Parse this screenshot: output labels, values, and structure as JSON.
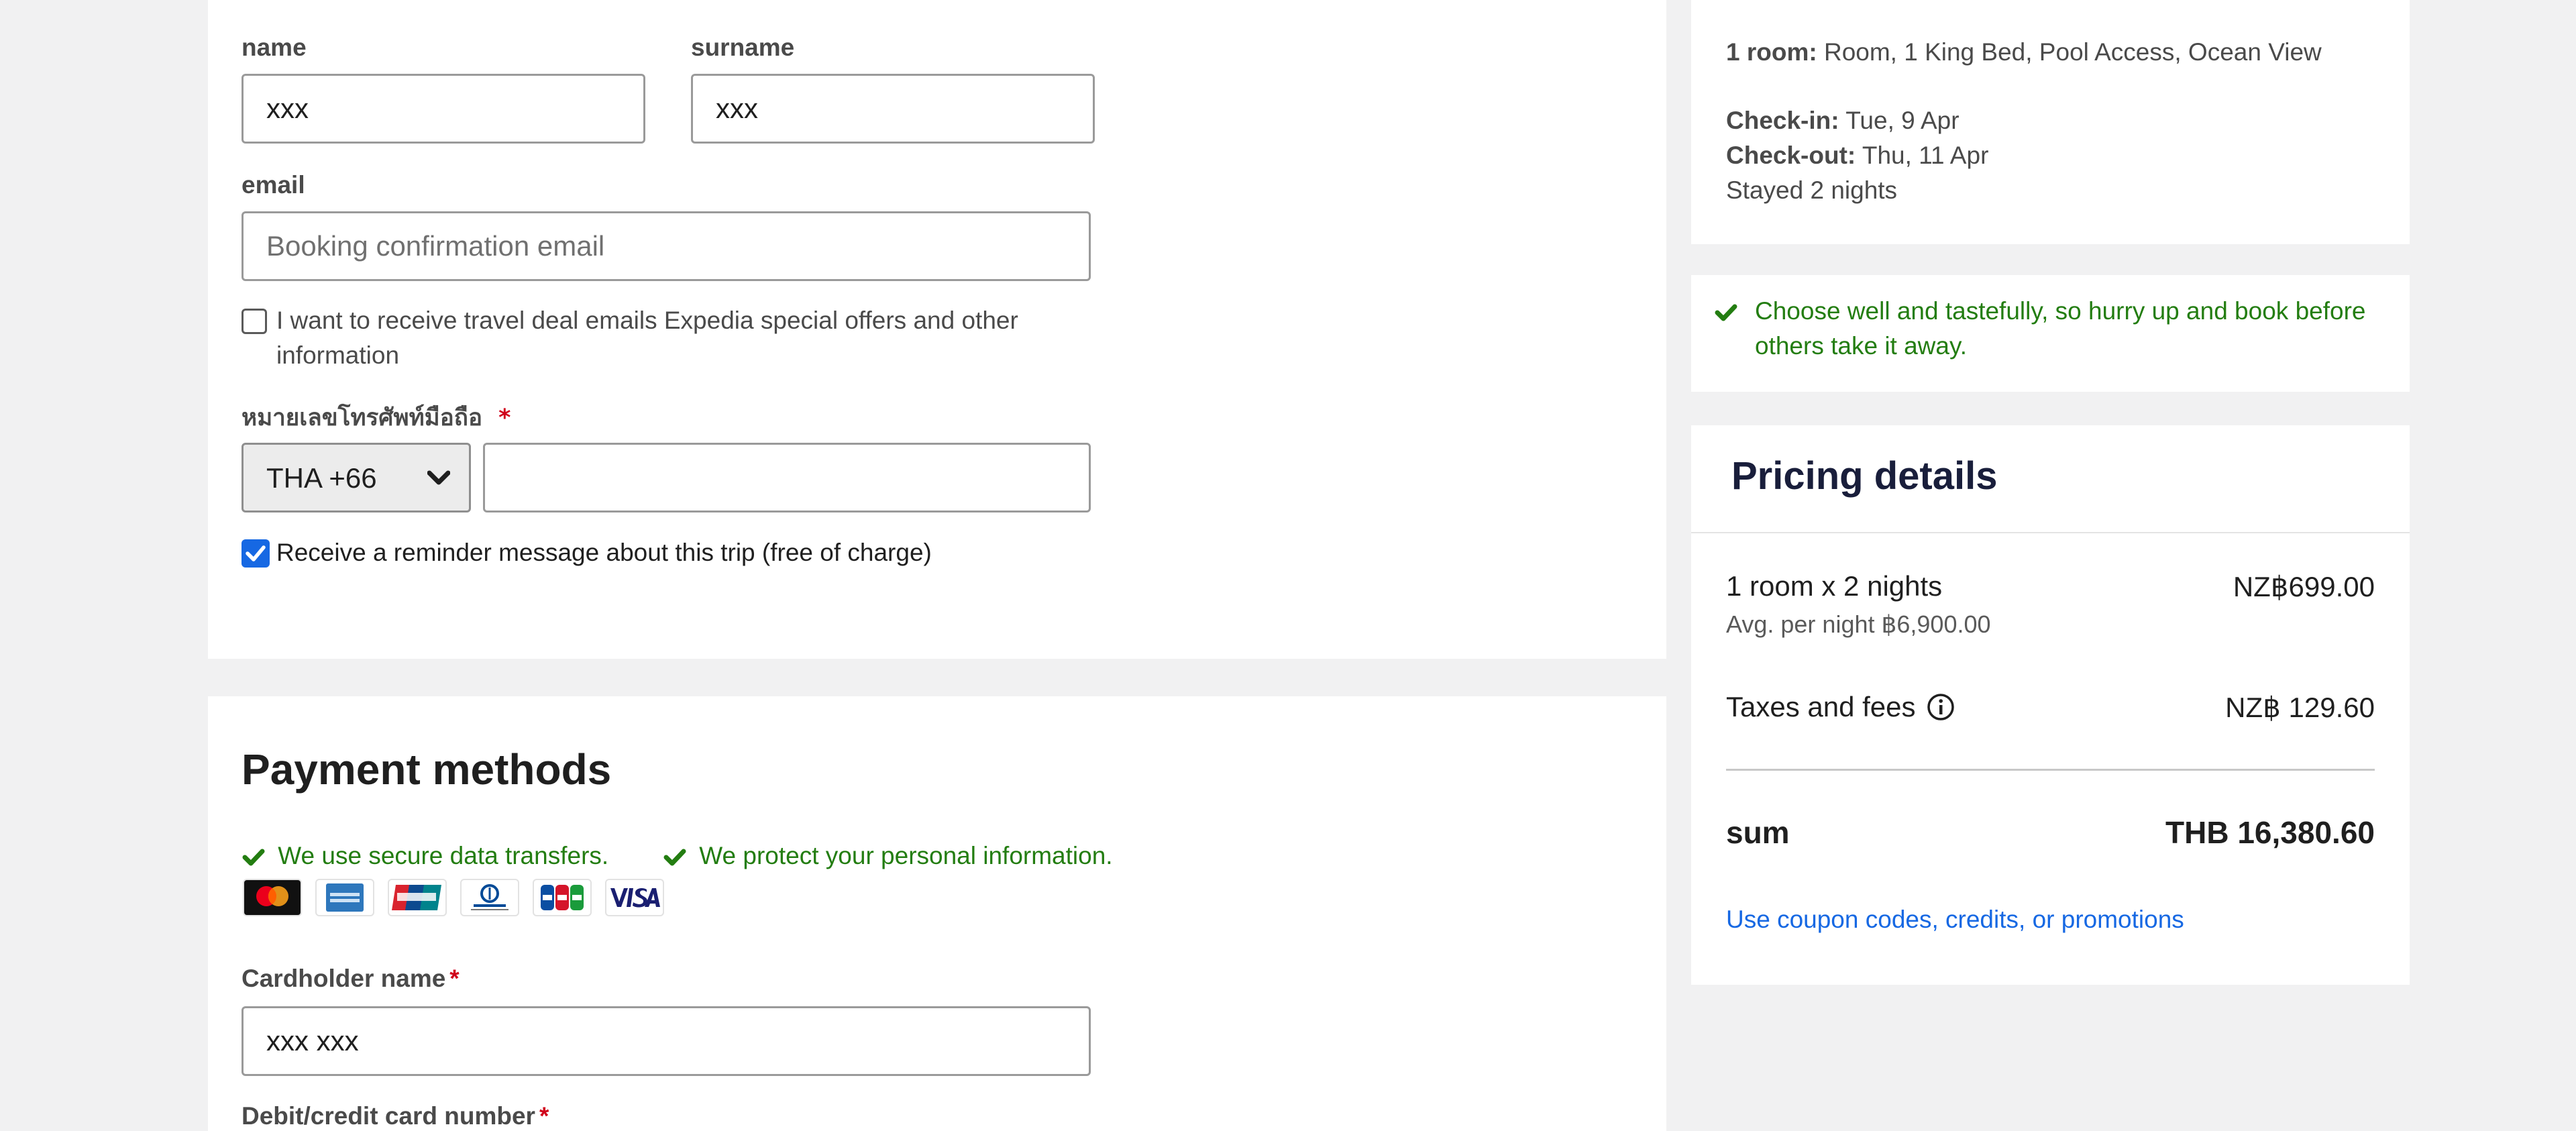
{
  "contact_form": {
    "name_label": "name",
    "name_value": "xxx",
    "surname_label": "surname",
    "surname_value": "xxx",
    "email_label": "email",
    "email_placeholder": "Booking confirmation email",
    "deals_checkbox_line1": "I want to receive travel deal emails Expedia special offers and other",
    "deals_checkbox_line2": "information",
    "deals_checked": false,
    "phone_label": "หมายเลขโทรศัพท์มือถือ",
    "phone_required": "*",
    "country_code": "THA +66",
    "phone_value": "",
    "reminder_label": "Receive a reminder message about this trip (free of charge)",
    "reminder_checked": true
  },
  "payment": {
    "title": "Payment methods",
    "secure_note": "We use secure data transfers.",
    "protect_note": "We protect your personal information.",
    "card_brands": [
      "Mastercard",
      "American Express",
      "UnionPay",
      "Diners Club",
      "JCB",
      "VISA"
    ],
    "cardholder_label": "Cardholder name",
    "cardholder_required": "*",
    "cardholder_value": "xxx xxx",
    "card_number_label": "Debit/credit card number",
    "card_number_required": "*"
  },
  "stay_summary": {
    "room_label": "1 room:",
    "room_value": " Room, 1 King Bed, Pool Access, Ocean View",
    "checkin_label": "Check-in:",
    "checkin_value": " Tue, 9 Apr",
    "checkout_label": "Check-out:",
    "checkout_value": " Thu, 11 Apr",
    "stayed": "Stayed 2 nights"
  },
  "urgency": {
    "line1": "Choose well and tastefully, so hurry up and book before",
    "line2": "others take it away."
  },
  "pricing": {
    "title": "Pricing details",
    "room_nights": "1 room x 2 nights",
    "room_nights_price": "NZ฿699.00",
    "avg_per_night": "Avg. per night ฿6,900.00",
    "taxes_label": "Taxes and fees",
    "taxes_price": "NZ฿ 129.60",
    "sum_label": "sum",
    "sum_value": "THB 16,380.60",
    "coupon_link": "Use coupon codes, credits, or promotions"
  },
  "colors": {
    "page_bg": "#f1f1f2",
    "card_bg": "#ffffff",
    "success_green": "#237d11",
    "link_blue": "#1668e3",
    "checkbox_blue": "#1668e3",
    "heading_navy": "#191e3b",
    "required_red": "#d0021b"
  },
  "icons": {
    "success": "check-icon",
    "info": "info-circle-icon",
    "select": "chevron-down-icon"
  }
}
